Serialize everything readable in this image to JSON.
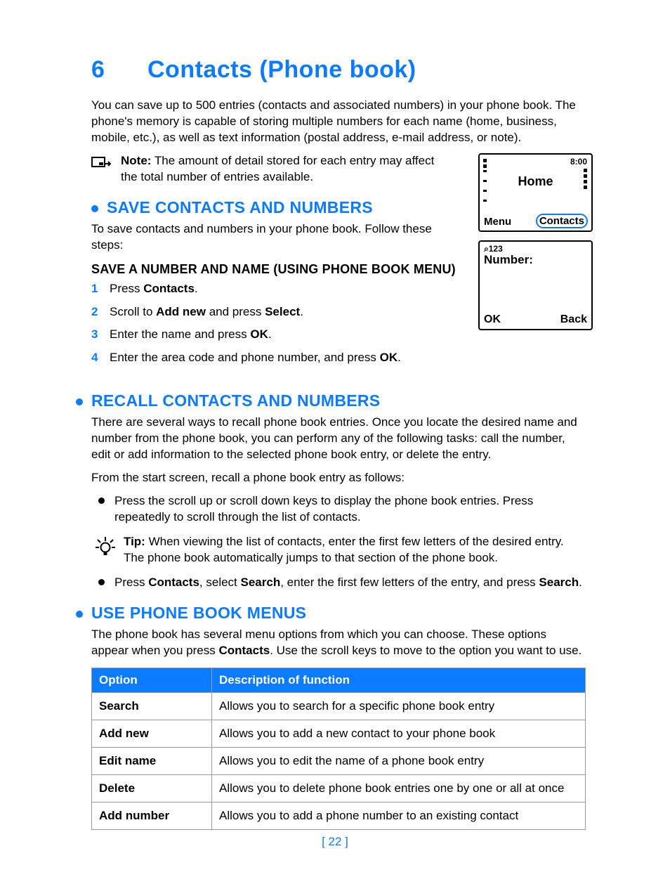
{
  "chapter": {
    "number": "6",
    "title": "Contacts (Phone book)"
  },
  "intro": "You can save up to 500 entries (contacts and associated numbers) in your phone book. The phone's memory is capable of storing multiple numbers for each name (home, business, mobile, etc.), as well as text information (postal address, e-mail address, or note).",
  "note": {
    "label": "Note:",
    "text": " The amount of detail stored for each entry may affect the total number of entries available."
  },
  "screens": {
    "home": {
      "time": "8:00",
      "title": "Home",
      "softleft": "Menu",
      "softright": "Contacts"
    },
    "number": {
      "mode": "⌕123",
      "label": "Number:",
      "softleft": "OK",
      "softright": "Back"
    }
  },
  "save_section": {
    "heading": "SAVE CONTACTS AND NUMBERS",
    "intro": "To save contacts and numbers in your phone book. Follow these steps:",
    "sub": "SAVE A NUMBER AND NAME (USING PHONE BOOK MENU)",
    "steps": [
      {
        "n": "1",
        "pre": "Press ",
        "b1": "Contacts",
        "post": "."
      },
      {
        "n": "2",
        "pre": "Scroll to ",
        "b1": "Add new",
        "mid": " and press ",
        "b2": "Select",
        "post": "."
      },
      {
        "n": "3",
        "pre": "Enter the name and press ",
        "b1": "OK",
        "post": "."
      },
      {
        "n": "4",
        "pre": "Enter the area code and phone number, and press ",
        "b1": "OK",
        "post": "."
      }
    ]
  },
  "recall_section": {
    "heading": "RECALL CONTACTS AND NUMBERS",
    "p1": "There are several ways to recall phone book entries. Once you locate the desired name and number from the phone book, you can perform any of the following tasks: call the number, edit or add information to the selected phone book entry, or delete the entry.",
    "p2": "From the start screen, recall a phone book entry as follows:",
    "b1": "Press the scroll up or scroll down keys to display the phone book entries. Press repeatedly to scroll through the list of contacts.",
    "tip": {
      "label": "Tip:",
      "text": " When viewing the list of contacts, enter the first few letters of the desired entry. The phone book automatically jumps to that section of the phone book."
    },
    "b2": {
      "t1": "Press ",
      "b1": "Contacts",
      "t2": ", select ",
      "b2": "Search",
      "t3": ", enter the first few letters of the entry, and press ",
      "b3": "Search",
      "t4": "."
    }
  },
  "menus_section": {
    "heading": "USE PHONE BOOK MENUS",
    "p_pre": "The phone book has several menu options from which you can choose. These options appear when you press ",
    "p_b": "Contacts",
    "p_post": ". Use the scroll keys to move to the option you want to use.",
    "headers": {
      "c1": "Option",
      "c2": "Description of function"
    },
    "rows": [
      {
        "opt": "Search",
        "desc": "Allows you to search for a specific phone book entry"
      },
      {
        "opt": "Add new",
        "desc": "Allows you to add a new contact to your phone book"
      },
      {
        "opt": "Edit name",
        "desc": "Allows you to edit the name of a phone book entry"
      },
      {
        "opt": "Delete",
        "desc": "Allows you to delete phone book entries one by one or all at once"
      },
      {
        "opt": "Add number",
        "desc": "Allows you to add a phone number to an existing contact"
      }
    ]
  },
  "page_number": "[ 22 ]"
}
